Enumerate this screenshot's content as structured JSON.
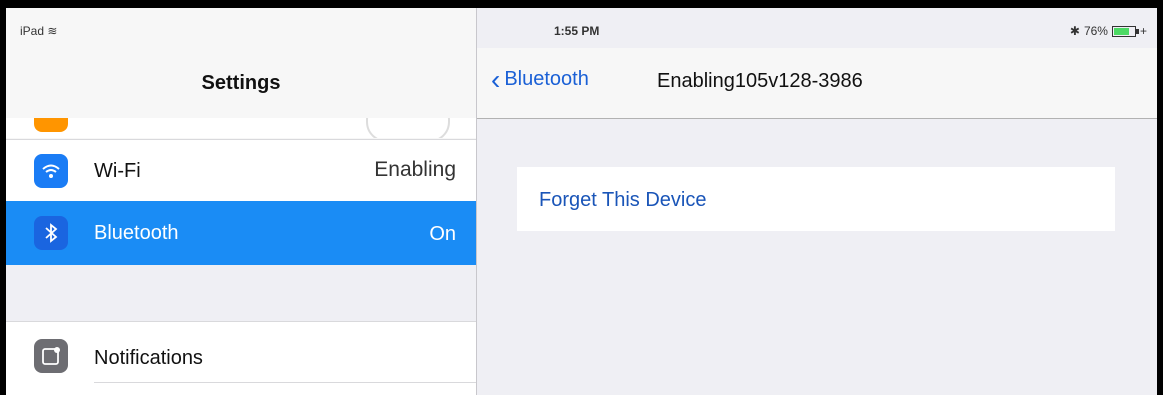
{
  "status_bar": {
    "device": "iPad",
    "time": "1:55 PM",
    "bluetooth_symbol": "✱",
    "battery": "76%",
    "battery_level": 0.76
  },
  "sidebar": {
    "title": "Settings",
    "items": [
      {
        "label": "Wi-Fi",
        "value": "Enabling",
        "icon": "wifi-icon"
      },
      {
        "label": "Bluetooth",
        "value": "On",
        "icon": "bluetooth-icon",
        "selected": true
      },
      {
        "label": "Notifications",
        "icon": "notifications-icon"
      }
    ]
  },
  "detail": {
    "back_label": "Bluetooth",
    "title": "Enabling105v128-3986",
    "forget_label": "Forget This Device"
  },
  "colors": {
    "accent": "#1a8cf5",
    "link": "#1a60d6"
  }
}
